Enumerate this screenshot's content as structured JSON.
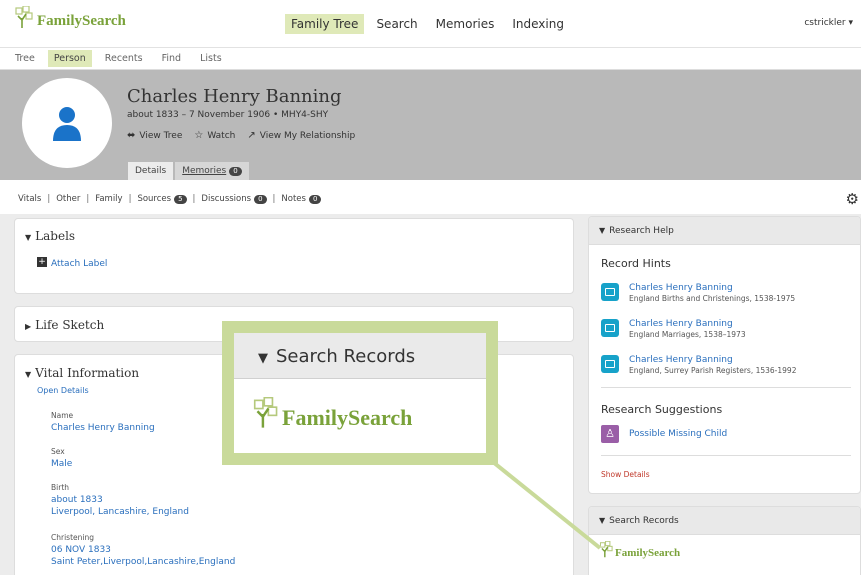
{
  "brand": {
    "name": "FamilySearch",
    "color": "#7aa23a"
  },
  "topnav": {
    "items": [
      "Family Tree",
      "Search",
      "Memories",
      "Indexing"
    ],
    "active": "Family Tree",
    "user": "cstrickler ▾"
  },
  "subnav": {
    "items": [
      "Tree",
      "Person",
      "Recents",
      "Find",
      "Lists"
    ],
    "active": "Person"
  },
  "person": {
    "name": "Charles Henry Banning",
    "meta": "about 1833 – 7 November 1906 • MHY4-SHY",
    "actions": [
      "View Tree",
      "Watch",
      "View My Relationship"
    ],
    "tabs": [
      {
        "label": "Details"
      },
      {
        "label": "Memories",
        "count": "0"
      }
    ]
  },
  "sections": {
    "vitals": "Vitals",
    "other": "Other",
    "family": "Family",
    "sources": "Sources",
    "sources_count": "5",
    "discussions": "Discussions",
    "discussions_count": "0",
    "notes": "Notes",
    "notes_count": "0"
  },
  "labels_card": {
    "title": "Labels",
    "attach": "Attach Label"
  },
  "life_sketch": {
    "title": "Life Sketch"
  },
  "vital_info": {
    "title": "Vital Information",
    "open_details": "Open Details",
    "name_label": "Name",
    "name_value": "Charles Henry Banning",
    "sex_label": "Sex",
    "sex_value": "Male",
    "birth_label": "Birth",
    "birth_date": "about 1833",
    "birth_place": "Liverpool, Lancashire, England",
    "christening_label": "Christening",
    "christening_date": "06 NOV 1833",
    "christening_place": "Saint Peter,Liverpool,Lancashire,England"
  },
  "research_help": {
    "header": "Research Help",
    "record_hints_title": "Record Hints",
    "hints": [
      {
        "name": "Charles Henry Banning",
        "collection": "England Births and Christenings, 1538-1975"
      },
      {
        "name": "Charles Henry Banning",
        "collection": "England Marriages, 1538–1973"
      },
      {
        "name": "Charles Henry Banning",
        "collection": "England, Surrey Parish Registers, 1536-1992"
      }
    ],
    "suggestions_title": "Research Suggestions",
    "suggestion": "Possible Missing Child",
    "show_details": "Show Details"
  },
  "search_records": {
    "header": "Search Records",
    "logo_text": "FamilySearch"
  },
  "callout": {
    "title": "Search Records",
    "logo_text": "FamilySearch"
  }
}
